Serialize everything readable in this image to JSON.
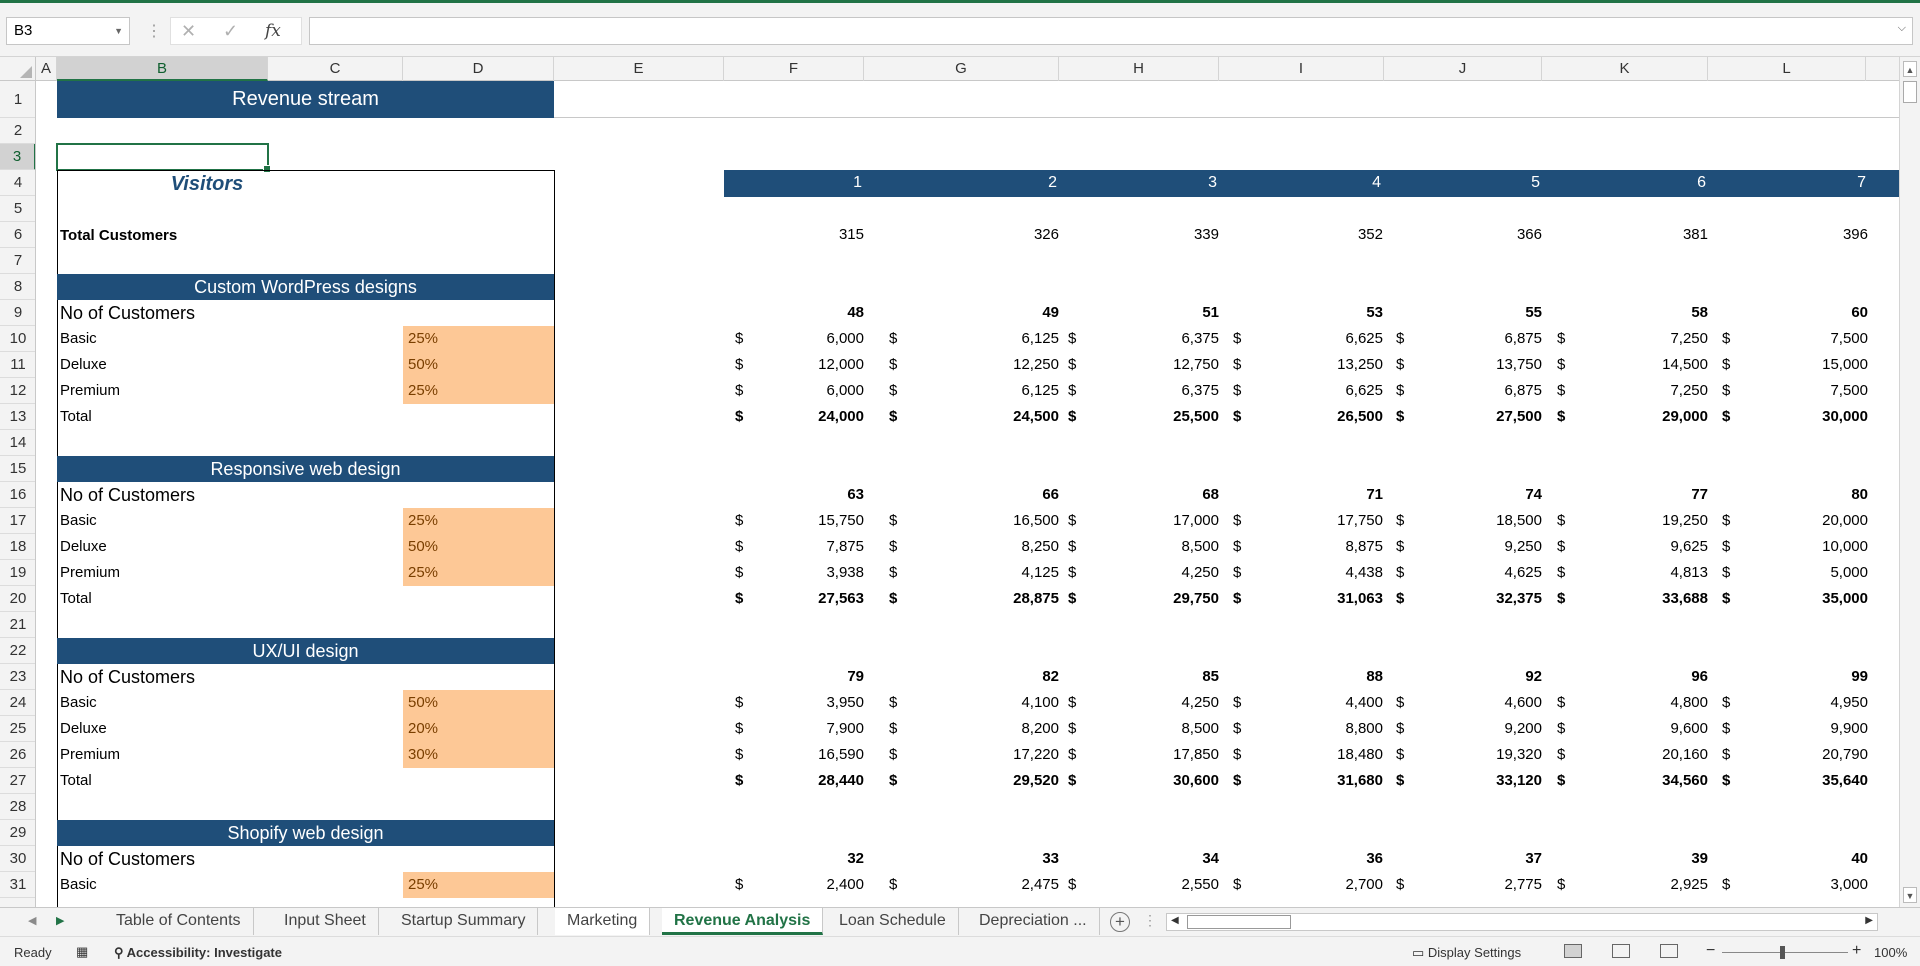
{
  "formula_bar": {
    "name_box": "B3",
    "cancel_icon": "✕",
    "enter_icon": "✓",
    "function_icon": "fx",
    "formula": ""
  },
  "columns": [
    "A",
    "B",
    "C",
    "D",
    "E",
    "F",
    "G",
    "H",
    "I",
    "J",
    "K",
    "L"
  ],
  "selected_column": "B",
  "rows": [
    "1",
    "2",
    "3",
    "4",
    "5",
    "6",
    "7",
    "8",
    "9",
    "10",
    "11",
    "12",
    "13",
    "14",
    "15",
    "16",
    "17",
    "18",
    "19",
    "20",
    "21",
    "22",
    "23",
    "24",
    "25",
    "26",
    "27",
    "28",
    "29",
    "30",
    "31"
  ],
  "selected_row": "3",
  "sheet": {
    "title": "Revenue stream",
    "visitors_label": "Visitors",
    "total_customers_label": "Total Customers",
    "period_headers": [
      "1",
      "2",
      "3",
      "4",
      "5",
      "6",
      "7"
    ],
    "total_customers": [
      "315",
      "326",
      "339",
      "352",
      "366",
      "381",
      "396"
    ],
    "currency": "$",
    "sections": [
      {
        "title": "Custom WordPress designs",
        "count_label": "No of Customers",
        "counts": [
          "48",
          "49",
          "51",
          "53",
          "55",
          "58",
          "60"
        ],
        "lines": [
          {
            "label": "Basic",
            "pct": "25%",
            "values": [
              "6,000",
              "6,125",
              "6,375",
              "6,625",
              "6,875",
              "7,250",
              "7,500"
            ]
          },
          {
            "label": "Deluxe",
            "pct": "50%",
            "values": [
              "12,000",
              "12,250",
              "12,750",
              "13,250",
              "13,750",
              "14,500",
              "15,000"
            ]
          },
          {
            "label": "Premium",
            "pct": "25%",
            "values": [
              "6,000",
              "6,125",
              "6,375",
              "6,625",
              "6,875",
              "7,250",
              "7,500"
            ]
          }
        ],
        "total_label": "Total",
        "totals": [
          "24,000",
          "24,500",
          "25,500",
          "26,500",
          "27,500",
          "29,000",
          "30,000"
        ]
      },
      {
        "title": "Responsive web design",
        "count_label": "No of Customers",
        "counts": [
          "63",
          "66",
          "68",
          "71",
          "74",
          "77",
          "80"
        ],
        "lines": [
          {
            "label": "Basic",
            "pct": "25%",
            "values": [
              "15,750",
              "16,500",
              "17,000",
              "17,750",
              "18,500",
              "19,250",
              "20,000"
            ]
          },
          {
            "label": "Deluxe",
            "pct": "50%",
            "values": [
              "7,875",
              "8,250",
              "8,500",
              "8,875",
              "9,250",
              "9,625",
              "10,000"
            ]
          },
          {
            "label": "Premium",
            "pct": "25%",
            "values": [
              "3,938",
              "4,125",
              "4,250",
              "4,438",
              "4,625",
              "4,813",
              "5,000"
            ]
          }
        ],
        "total_label": "Total",
        "totals": [
          "27,563",
          "28,875",
          "29,750",
          "31,063",
          "32,375",
          "33,688",
          "35,000"
        ]
      },
      {
        "title": "UX/UI design",
        "count_label": "No of Customers",
        "counts": [
          "79",
          "82",
          "85",
          "88",
          "92",
          "96",
          "99"
        ],
        "lines": [
          {
            "label": "Basic",
            "pct": "50%",
            "values": [
              "3,950",
              "4,100",
              "4,250",
              "4,400",
              "4,600",
              "4,800",
              "4,950"
            ]
          },
          {
            "label": "Deluxe",
            "pct": "20%",
            "values": [
              "7,900",
              "8,200",
              "8,500",
              "8,800",
              "9,200",
              "9,600",
              "9,900"
            ]
          },
          {
            "label": "Premium",
            "pct": "30%",
            "values": [
              "16,590",
              "17,220",
              "17,850",
              "18,480",
              "19,320",
              "20,160",
              "20,790"
            ]
          }
        ],
        "total_label": "Total",
        "totals": [
          "28,440",
          "29,520",
          "30,600",
          "31,680",
          "33,120",
          "34,560",
          "35,640"
        ]
      },
      {
        "title": "Shopify web design",
        "count_label": "No of Customers",
        "counts": [
          "32",
          "33",
          "34",
          "36",
          "37",
          "39",
          "40"
        ],
        "lines": [
          {
            "label": "Basic",
            "pct": "25%",
            "values": [
              "2,400",
              "2,475",
              "2,550",
              "2,700",
              "2,775",
              "2,925",
              "3,000"
            ]
          }
        ],
        "total_label": "",
        "totals": []
      }
    ]
  },
  "tabs": [
    {
      "label": "Table of Contents",
      "active": false
    },
    {
      "label": "Input Sheet",
      "active": false
    },
    {
      "label": "Startup Summary",
      "active": false
    },
    {
      "label": "Marketing",
      "active": false
    },
    {
      "label": "Revenue Analysis",
      "active": true
    },
    {
      "label": "Loan Schedule",
      "active": false
    },
    {
      "label": "Depreciation ...",
      "active": false
    }
  ],
  "status_bar": {
    "mode": "Ready",
    "accessibility": "Accessibility: Investigate",
    "display_settings": "Display Settings",
    "zoom": "100%"
  },
  "colors": {
    "navy": "#1f4e79",
    "input_orange": "#fdc896",
    "excel_green": "#217346"
  }
}
